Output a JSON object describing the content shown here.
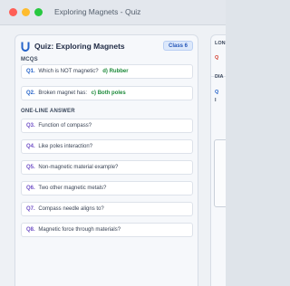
{
  "window": {
    "title": "Exploring Magnets - Quiz"
  },
  "quiz": {
    "title": "Quiz: Exploring Magnets",
    "badge": "Class 6",
    "sections": {
      "mcqs": {
        "label": "MCQS",
        "items": [
          {
            "num": "Q1.",
            "text": "Which is NOT magnetic?",
            "answer": "d) Rubber"
          },
          {
            "num": "Q2.",
            "text": "Broken magnet has:",
            "answer": "c) Both poles"
          }
        ]
      },
      "one_line": {
        "label": "ONE-LINE ANSWER",
        "items": [
          {
            "num": "Q3.",
            "text": "Function of compass?"
          },
          {
            "num": "Q4.",
            "text": "Like poles interaction?"
          },
          {
            "num": "Q5.",
            "text": "Non-magnetic material example?"
          },
          {
            "num": "Q6.",
            "text": "Two other magnetic metals?"
          },
          {
            "num": "Q7.",
            "text": "Compass needle aligns to?"
          },
          {
            "num": "Q8.",
            "text": "Magnetic force through materials?"
          }
        ]
      }
    }
  },
  "right_panel": {
    "heading_1": "LON",
    "q_red": "Q",
    "heading_2": "DIA",
    "q_blue": "Q",
    "sub": "I"
  },
  "colors": {
    "accent": "#2563c9",
    "answer": "#1d8a3a",
    "purple": "#6f4fc6",
    "red": "#d33a2c"
  }
}
